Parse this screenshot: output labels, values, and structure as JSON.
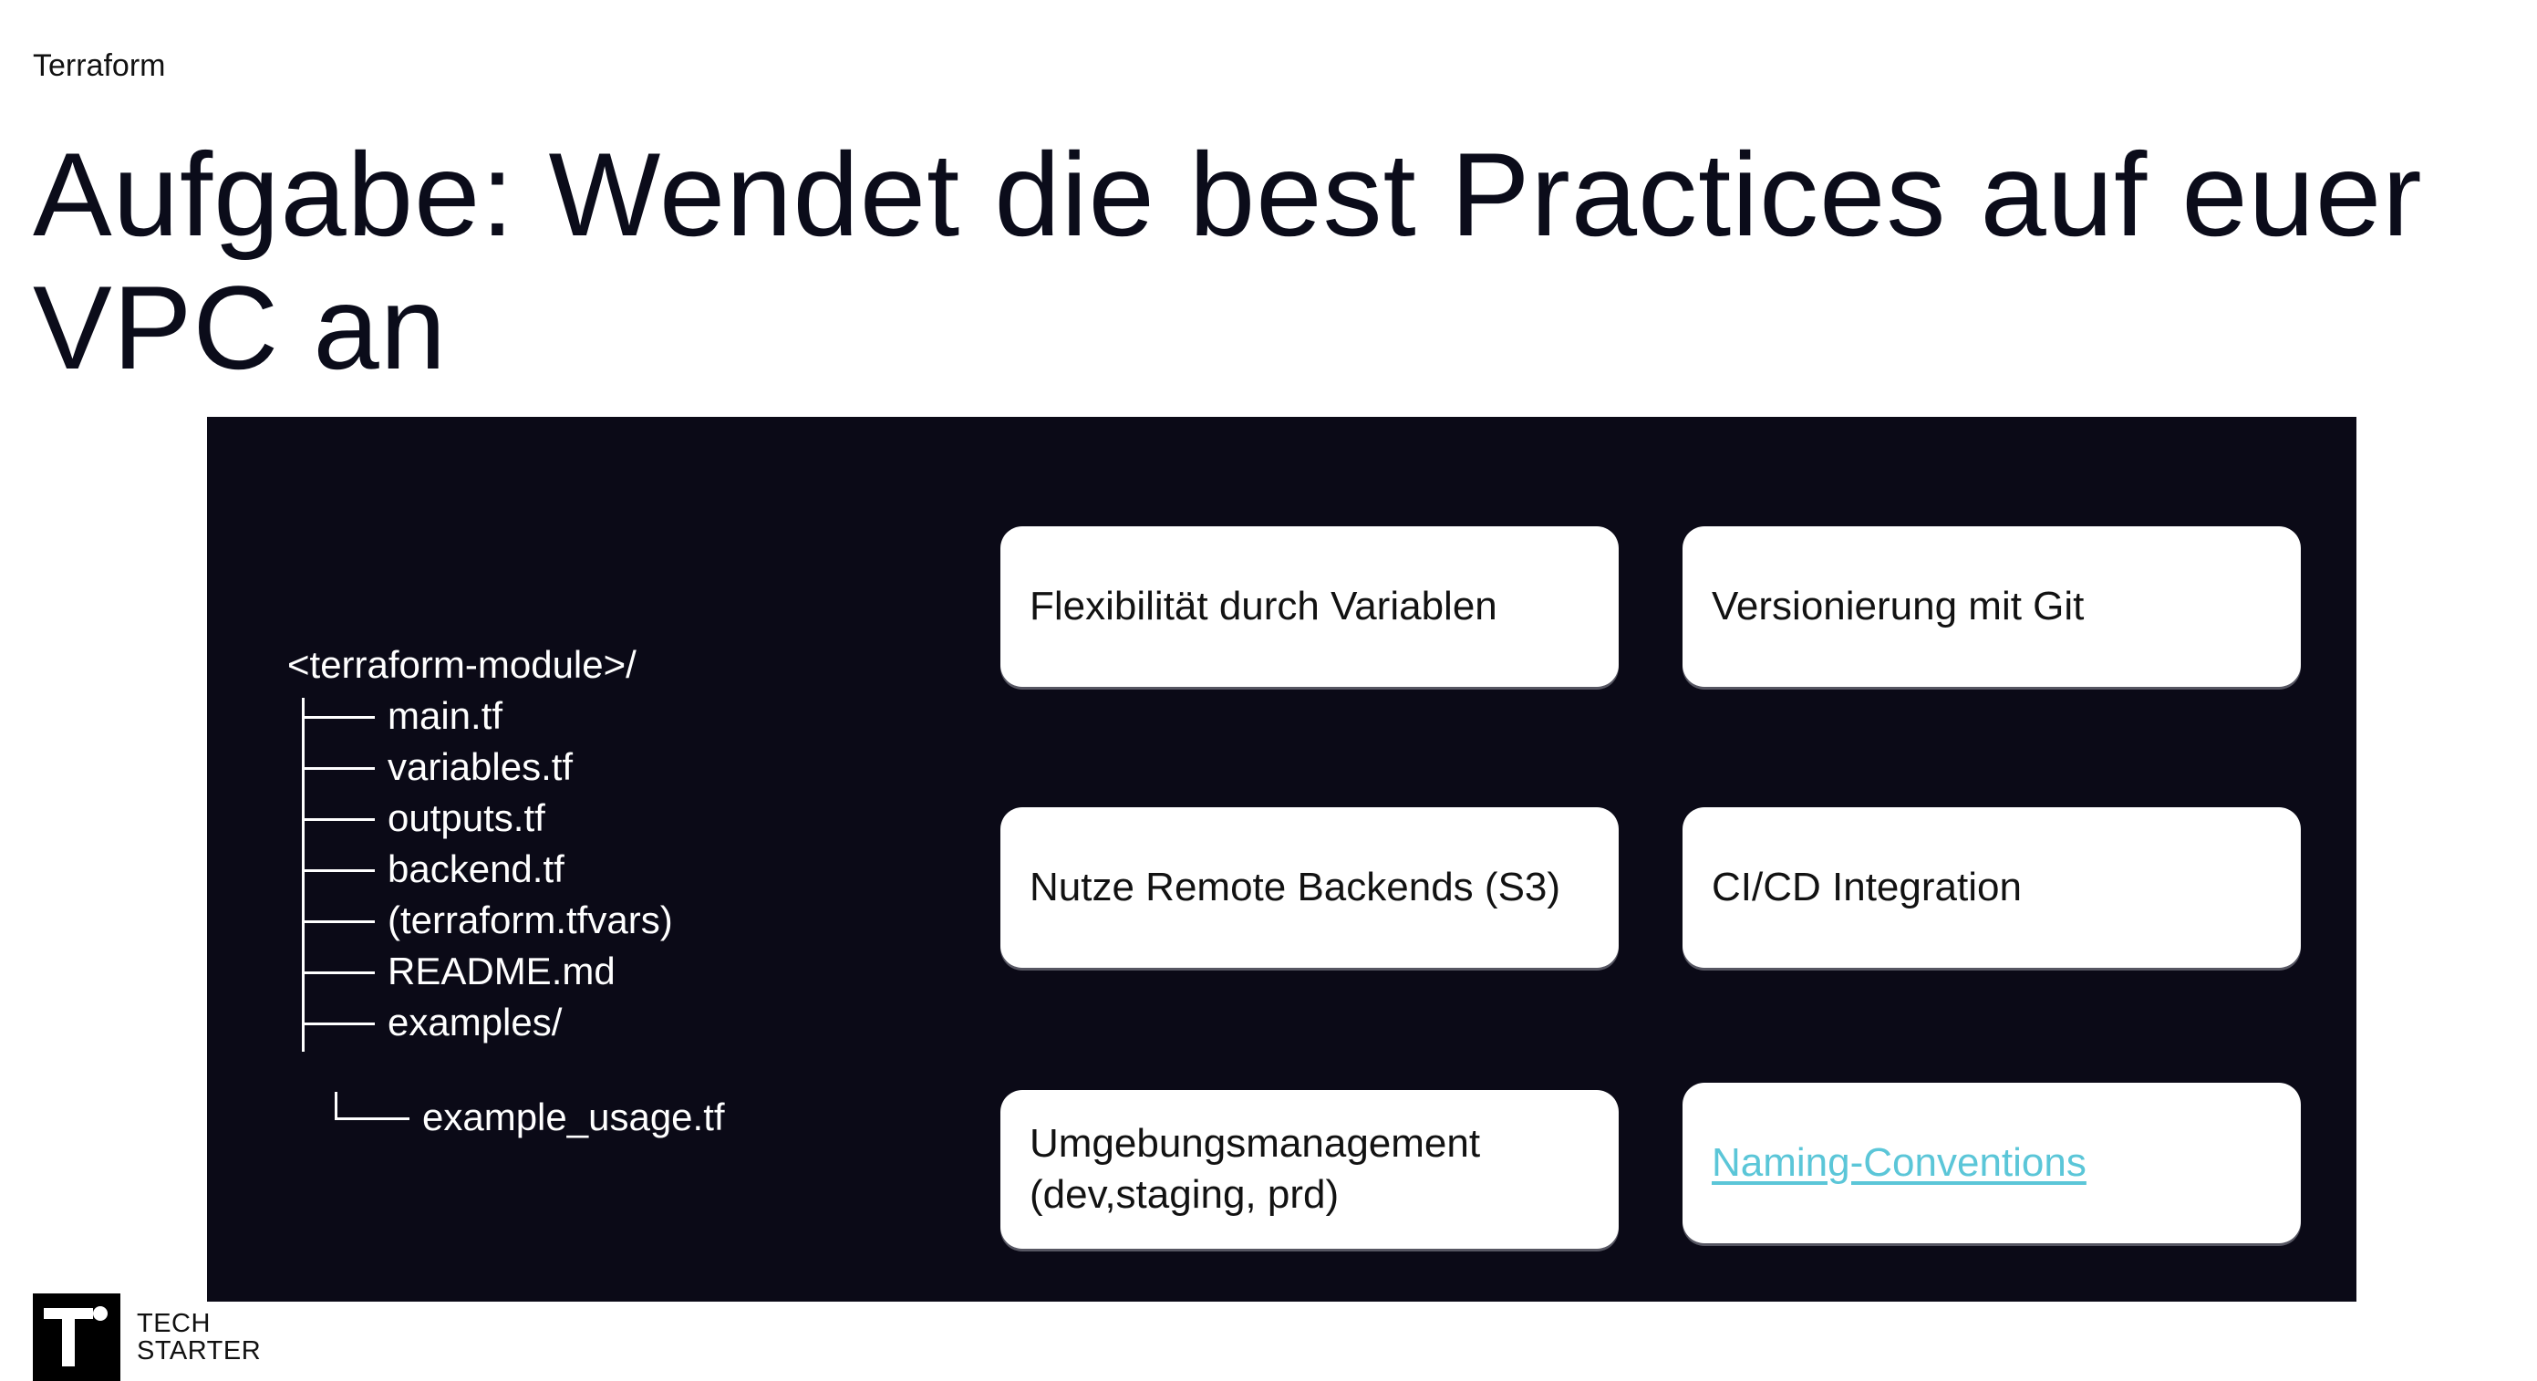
{
  "header": {
    "section_label": "Terraform",
    "title": "Aufgabe: Wendet die best Practices auf euer VPC an"
  },
  "diagram": {
    "tree_root": "<terraform-module>/",
    "tree_items": [
      "main.tf",
      "variables.tf",
      "outputs.tf",
      "backend.tf",
      "(terraform.tfvars)",
      "README.md",
      "examples/"
    ],
    "tree_sub_item": "example_usage.tf",
    "cards": [
      {
        "label": "Flexibilität durch Variablen"
      },
      {
        "label": "Versionierung mit Git"
      },
      {
        "label": "Nutze Remote Backends (S3)"
      },
      {
        "label": "CI/CD Integration"
      },
      {
        "label_line1": "Umgebungsmanagement",
        "label_line2": "(dev,staging, prd)"
      },
      {
        "label": "Naming-Conventions"
      }
    ]
  },
  "footer": {
    "brand_line1": "TECH",
    "brand_line2": "STARTER"
  },
  "colors": {
    "diagram_background": "#0b0a17",
    "link": "#5bc6d8",
    "title": "#0b0c1a"
  }
}
